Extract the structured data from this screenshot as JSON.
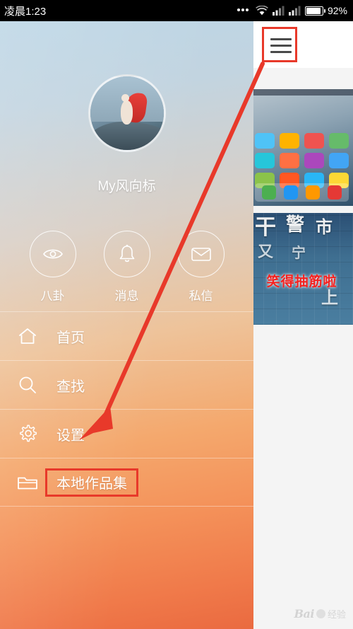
{
  "status_bar": {
    "time": "凌晨1:23",
    "battery_percent": "92%",
    "icons": [
      "more-dots-icon",
      "wifi-icon",
      "signal-icon",
      "signal-icon-2",
      "battery-icon"
    ]
  },
  "drawer": {
    "username": "My风向标",
    "avatar_name": "user-avatar",
    "circle_actions": [
      {
        "label": "八卦",
        "icon": "eye-icon"
      },
      {
        "label": "消息",
        "icon": "bell-icon"
      },
      {
        "label": "私信",
        "icon": "envelope-icon"
      }
    ],
    "menu_items": [
      {
        "label": "首页",
        "icon": "home-icon",
        "highlighted": false
      },
      {
        "label": "查找",
        "icon": "search-icon",
        "highlighted": false
      },
      {
        "label": "设置",
        "icon": "gear-icon",
        "highlighted": false
      },
      {
        "label": "本地作品集",
        "icon": "folder-icon",
        "highlighted": true
      }
    ]
  },
  "right_pane": {
    "menu_button_name": "hamburger-menu-button",
    "feed": [
      {
        "name": "feed-card-phone-screenshot",
        "caption": ""
      },
      {
        "name": "feed-card-graffiti",
        "caption": "笑得抽筋啦",
        "wall_chars": [
          "干",
          "警",
          "市",
          "又",
          "宁",
          "上"
        ]
      }
    ]
  },
  "watermark": {
    "logo": "Bai",
    "text": "经验"
  },
  "annotations": {
    "arrow_color": "#e8392a",
    "highlight_color": "#e8392a",
    "arrow_from": "hamburger-menu-button",
    "arrow_to": "menu-item-local-works"
  }
}
